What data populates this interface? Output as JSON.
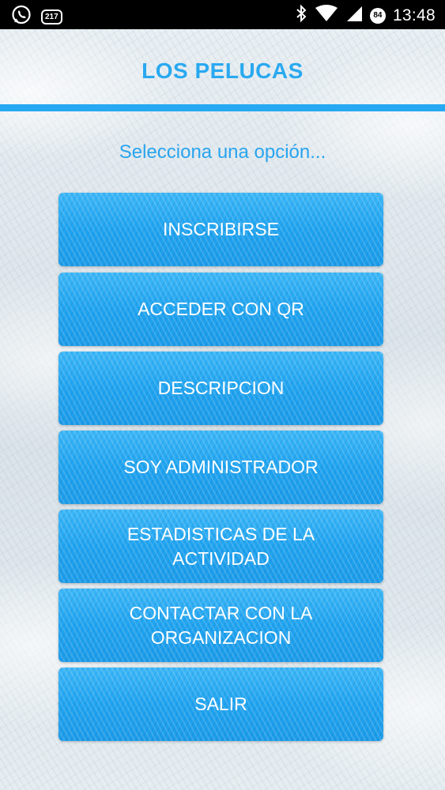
{
  "status_bar": {
    "time": "13:48",
    "notification_badge": "217",
    "battery_level": "84",
    "icons": [
      "whatsapp-icon",
      "notification-badge-icon",
      "bluetooth-icon",
      "wifi-icon",
      "signal-icon",
      "battery-icon"
    ]
  },
  "header": {
    "title": "LOS PELUCAS"
  },
  "prompt": "Selecciona una opción...",
  "menu": {
    "items": [
      {
        "label": "INSCRIBIRSE"
      },
      {
        "label": "ACCEDER CON QR"
      },
      {
        "label": "DESCRIPCION"
      },
      {
        "label": "SOY ADMINISTRADOR"
      },
      {
        "label": "ESTADISTICAS DE LA\nACTIVIDAD"
      },
      {
        "label": "CONTACTAR CON LA\nORGANIZACION"
      },
      {
        "label": "SALIR"
      }
    ]
  },
  "colors": {
    "accent": "#27a8f3",
    "button": "#20a4f0",
    "status_bar": "#000000"
  }
}
